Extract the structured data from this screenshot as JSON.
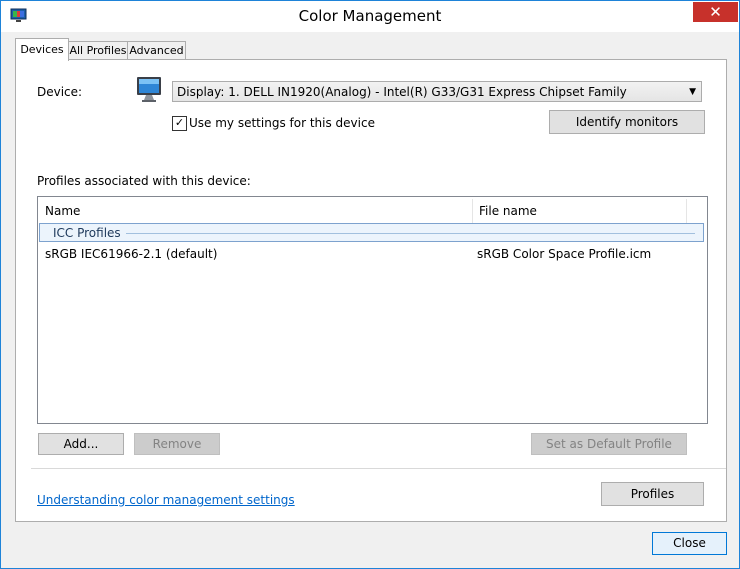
{
  "window": {
    "title": "Color Management",
    "close_glyph": "✕"
  },
  "tabs": [
    {
      "label": "Devices"
    },
    {
      "label": "All Profiles"
    },
    {
      "label": "Advanced"
    }
  ],
  "device": {
    "label": "Device:",
    "selected": "Display: 1. DELL IN1920(Analog) - Intel(R) G33/G31 Express Chipset Family",
    "use_my_settings_label": "Use my settings for this device",
    "use_my_settings_checked": true,
    "check_glyph": "✓",
    "identify_button": "Identify monitors"
  },
  "profiles": {
    "section_label": "Profiles associated with this device:",
    "columns": [
      "Name",
      "File name"
    ],
    "group": "ICC Profiles",
    "rows": [
      {
        "name": "sRGB IEC61966-2.1 (default)",
        "file": "sRGB Color Space Profile.icm"
      }
    ]
  },
  "buttons": {
    "add": "Add...",
    "remove": "Remove",
    "set_default": "Set as Default Profile",
    "profiles": "Profiles",
    "close": "Close"
  },
  "link": "Understanding color management settings",
  "icons": {
    "app": "color-management-icon",
    "device": "monitor-icon",
    "dropdown": "chevron-down-icon"
  },
  "colors": {
    "accent": "#0078d7",
    "close_bg": "#c7312b",
    "link": "#0066cc"
  }
}
